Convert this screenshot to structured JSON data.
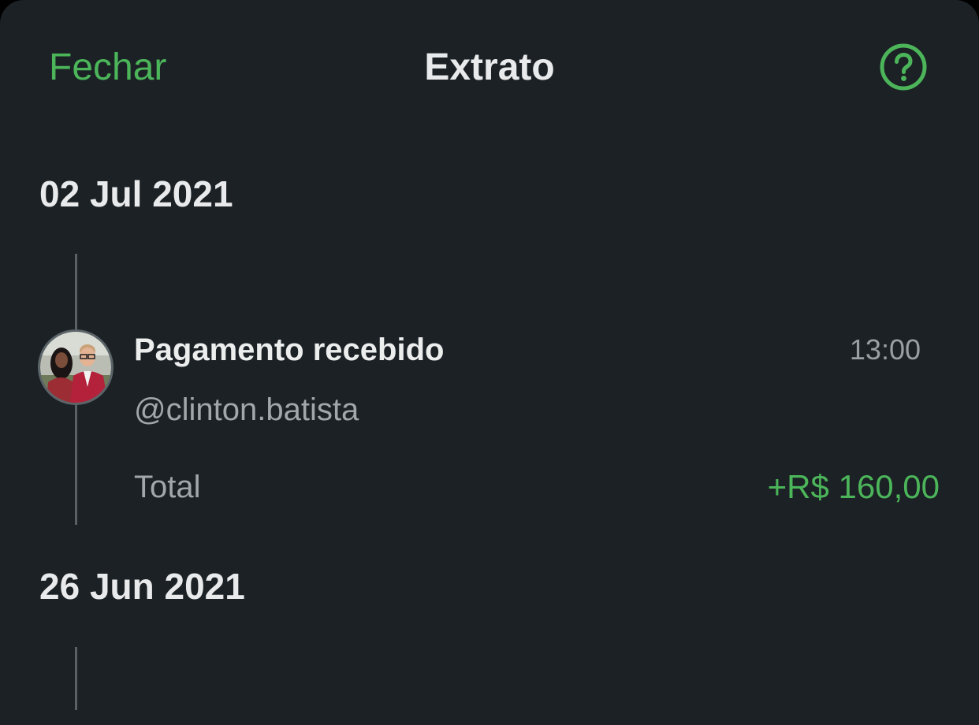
{
  "header": {
    "close_label": "Fechar",
    "title": "Extrato",
    "help_icon": "question-circle-icon"
  },
  "colors": {
    "background": "#1b2125",
    "accent": "#4cb55a",
    "text_primary": "#e9eaeb",
    "text_secondary": "#a2a7aa"
  },
  "groups": [
    {
      "date": "02 Jul 2021",
      "transactions": [
        {
          "title": "Pagamento recebido",
          "time": "13:00",
          "user": "@clinton.batista",
          "total_label": "Total",
          "amount": "+R$ 160,00",
          "avatar_icon": "user-avatar-photo"
        }
      ]
    },
    {
      "date": "26 Jun 2021",
      "transactions": []
    }
  ]
}
